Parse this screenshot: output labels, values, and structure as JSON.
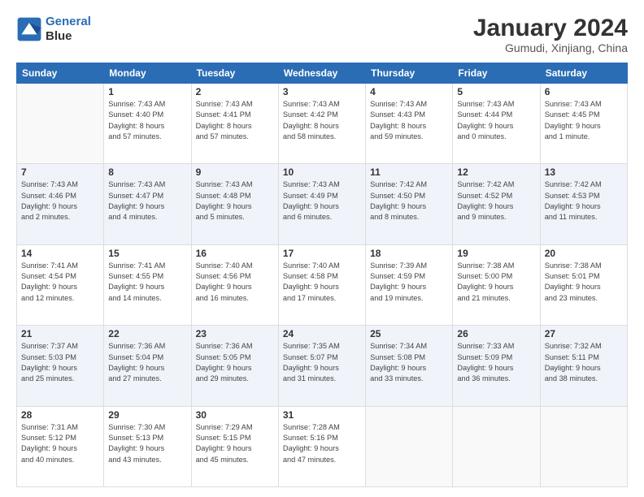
{
  "header": {
    "logo_line1": "General",
    "logo_line2": "Blue",
    "month": "January 2024",
    "location": "Gumudi, Xinjiang, China"
  },
  "days_of_week": [
    "Sunday",
    "Monday",
    "Tuesday",
    "Wednesday",
    "Thursday",
    "Friday",
    "Saturday"
  ],
  "weeks": [
    {
      "shade": false,
      "days": [
        {
          "num": "",
          "info": ""
        },
        {
          "num": "1",
          "info": "Sunrise: 7:43 AM\nSunset: 4:40 PM\nDaylight: 8 hours\nand 57 minutes."
        },
        {
          "num": "2",
          "info": "Sunrise: 7:43 AM\nSunset: 4:41 PM\nDaylight: 8 hours\nand 57 minutes."
        },
        {
          "num": "3",
          "info": "Sunrise: 7:43 AM\nSunset: 4:42 PM\nDaylight: 8 hours\nand 58 minutes."
        },
        {
          "num": "4",
          "info": "Sunrise: 7:43 AM\nSunset: 4:43 PM\nDaylight: 8 hours\nand 59 minutes."
        },
        {
          "num": "5",
          "info": "Sunrise: 7:43 AM\nSunset: 4:44 PM\nDaylight: 9 hours\nand 0 minutes."
        },
        {
          "num": "6",
          "info": "Sunrise: 7:43 AM\nSunset: 4:45 PM\nDaylight: 9 hours\nand 1 minute."
        }
      ]
    },
    {
      "shade": true,
      "days": [
        {
          "num": "7",
          "info": "Sunrise: 7:43 AM\nSunset: 4:46 PM\nDaylight: 9 hours\nand 2 minutes."
        },
        {
          "num": "8",
          "info": "Sunrise: 7:43 AM\nSunset: 4:47 PM\nDaylight: 9 hours\nand 4 minutes."
        },
        {
          "num": "9",
          "info": "Sunrise: 7:43 AM\nSunset: 4:48 PM\nDaylight: 9 hours\nand 5 minutes."
        },
        {
          "num": "10",
          "info": "Sunrise: 7:43 AM\nSunset: 4:49 PM\nDaylight: 9 hours\nand 6 minutes."
        },
        {
          "num": "11",
          "info": "Sunrise: 7:42 AM\nSunset: 4:50 PM\nDaylight: 9 hours\nand 8 minutes."
        },
        {
          "num": "12",
          "info": "Sunrise: 7:42 AM\nSunset: 4:52 PM\nDaylight: 9 hours\nand 9 minutes."
        },
        {
          "num": "13",
          "info": "Sunrise: 7:42 AM\nSunset: 4:53 PM\nDaylight: 9 hours\nand 11 minutes."
        }
      ]
    },
    {
      "shade": false,
      "days": [
        {
          "num": "14",
          "info": "Sunrise: 7:41 AM\nSunset: 4:54 PM\nDaylight: 9 hours\nand 12 minutes."
        },
        {
          "num": "15",
          "info": "Sunrise: 7:41 AM\nSunset: 4:55 PM\nDaylight: 9 hours\nand 14 minutes."
        },
        {
          "num": "16",
          "info": "Sunrise: 7:40 AM\nSunset: 4:56 PM\nDaylight: 9 hours\nand 16 minutes."
        },
        {
          "num": "17",
          "info": "Sunrise: 7:40 AM\nSunset: 4:58 PM\nDaylight: 9 hours\nand 17 minutes."
        },
        {
          "num": "18",
          "info": "Sunrise: 7:39 AM\nSunset: 4:59 PM\nDaylight: 9 hours\nand 19 minutes."
        },
        {
          "num": "19",
          "info": "Sunrise: 7:38 AM\nSunset: 5:00 PM\nDaylight: 9 hours\nand 21 minutes."
        },
        {
          "num": "20",
          "info": "Sunrise: 7:38 AM\nSunset: 5:01 PM\nDaylight: 9 hours\nand 23 minutes."
        }
      ]
    },
    {
      "shade": true,
      "days": [
        {
          "num": "21",
          "info": "Sunrise: 7:37 AM\nSunset: 5:03 PM\nDaylight: 9 hours\nand 25 minutes."
        },
        {
          "num": "22",
          "info": "Sunrise: 7:36 AM\nSunset: 5:04 PM\nDaylight: 9 hours\nand 27 minutes."
        },
        {
          "num": "23",
          "info": "Sunrise: 7:36 AM\nSunset: 5:05 PM\nDaylight: 9 hours\nand 29 minutes."
        },
        {
          "num": "24",
          "info": "Sunrise: 7:35 AM\nSunset: 5:07 PM\nDaylight: 9 hours\nand 31 minutes."
        },
        {
          "num": "25",
          "info": "Sunrise: 7:34 AM\nSunset: 5:08 PM\nDaylight: 9 hours\nand 33 minutes."
        },
        {
          "num": "26",
          "info": "Sunrise: 7:33 AM\nSunset: 5:09 PM\nDaylight: 9 hours\nand 36 minutes."
        },
        {
          "num": "27",
          "info": "Sunrise: 7:32 AM\nSunset: 5:11 PM\nDaylight: 9 hours\nand 38 minutes."
        }
      ]
    },
    {
      "shade": false,
      "days": [
        {
          "num": "28",
          "info": "Sunrise: 7:31 AM\nSunset: 5:12 PM\nDaylight: 9 hours\nand 40 minutes."
        },
        {
          "num": "29",
          "info": "Sunrise: 7:30 AM\nSunset: 5:13 PM\nDaylight: 9 hours\nand 43 minutes."
        },
        {
          "num": "30",
          "info": "Sunrise: 7:29 AM\nSunset: 5:15 PM\nDaylight: 9 hours\nand 45 minutes."
        },
        {
          "num": "31",
          "info": "Sunrise: 7:28 AM\nSunset: 5:16 PM\nDaylight: 9 hours\nand 47 minutes."
        },
        {
          "num": "",
          "info": ""
        },
        {
          "num": "",
          "info": ""
        },
        {
          "num": "",
          "info": ""
        }
      ]
    }
  ]
}
